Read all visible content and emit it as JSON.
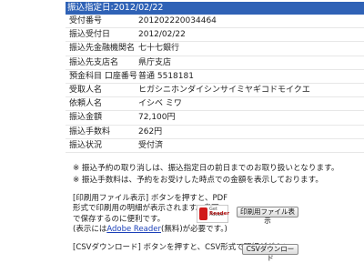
{
  "header": {
    "title": "振込指定日:2012/02/22"
  },
  "details": [
    {
      "label": "受付番号",
      "value": "201202220034464"
    },
    {
      "label": "振込受付日",
      "value": "2012/02/22"
    },
    {
      "label": "振込先金融機関名",
      "value": "七十七銀行"
    },
    {
      "label": "振込先支店名",
      "value": "県庁支店"
    },
    {
      "label": "預金科目 口座番号",
      "value": "普通 5518181"
    },
    {
      "label": "受取人名",
      "value": "ヒガシニホンダイシンサイミヤギコドモイクエ"
    },
    {
      "label": "依頼人名",
      "value": "イシベ ミワ"
    },
    {
      "label": "振込金額",
      "value": "72,100円"
    },
    {
      "label": "振込手数料",
      "value": "262円"
    },
    {
      "label": "振込状況",
      "value": "受付済"
    }
  ],
  "notes": [
    "※ 振込予約の取り消しは、振込指定日の前日までのお取り扱いとなります。",
    "※ 振込手数料は、予約をお受けした時点での金額を表示しております。"
  ],
  "print": {
    "line1": "[印刷用ファイル表示] ボタンを押すと、PDF",
    "line2": "形式で印刷用の明細が表示されます。書面",
    "line3": "で保存するのに便利です。",
    "line4_before": "(表示には",
    "line4_link": "Adobe Reader",
    "line4_after": "(無料)が必要です。)",
    "button": "印刷用ファイル表示",
    "adobe_get": "Get Adobe",
    "adobe_name": "Reader"
  },
  "csv": {
    "line1": "[CSVダウンロード] ボタンを押すと、CSV形式で明細がダウン",
    "button": "CSVダウンロード"
  }
}
